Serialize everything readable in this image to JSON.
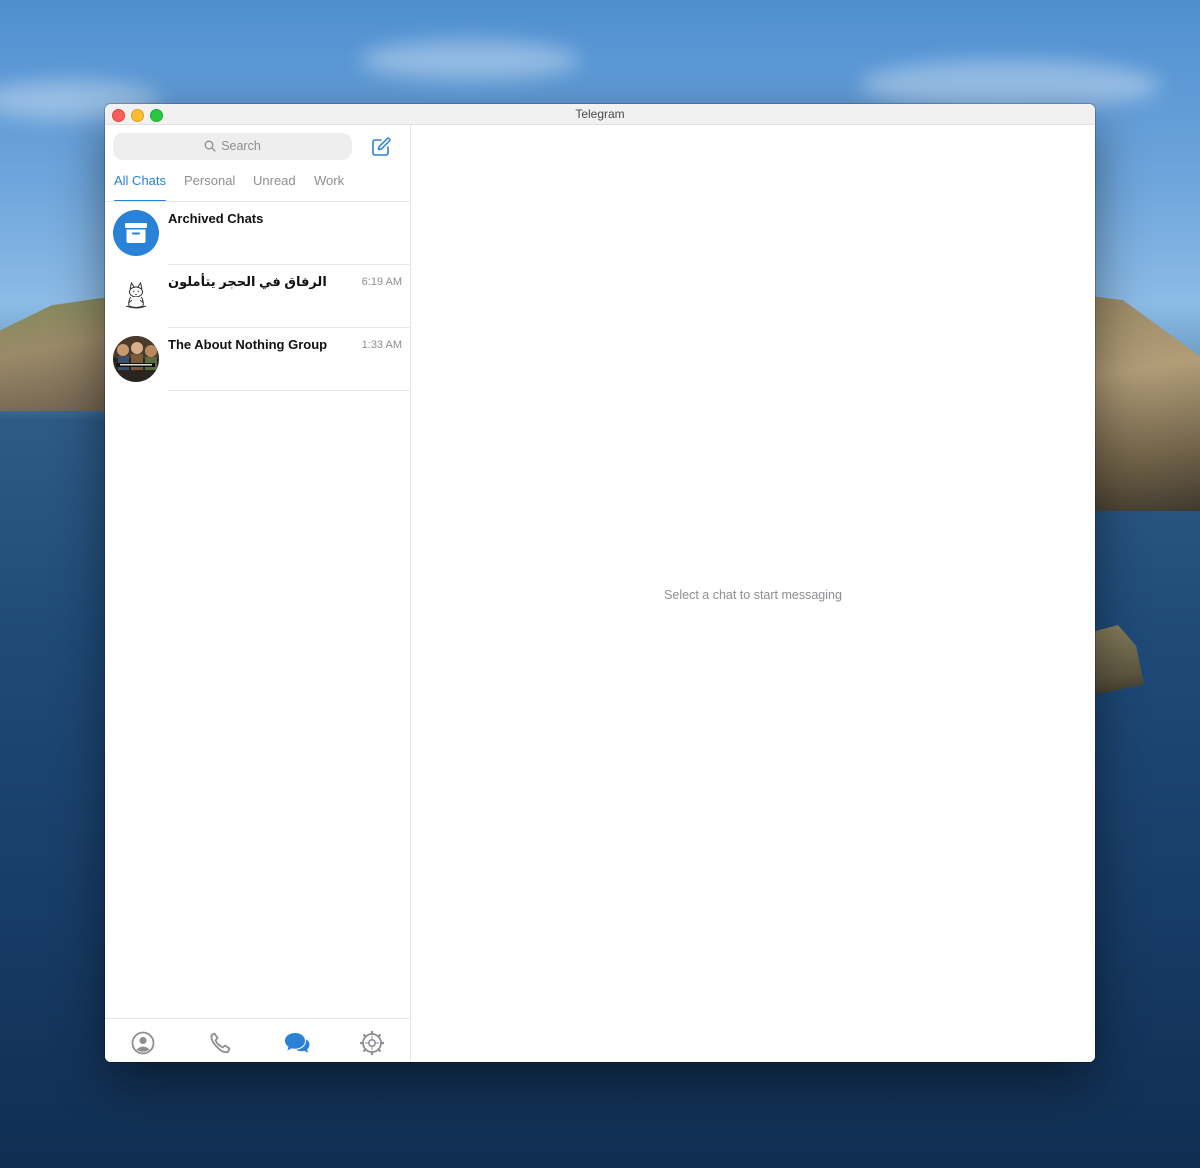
{
  "window": {
    "title": "Telegram"
  },
  "sidebar": {
    "search": {
      "placeholder": "Search"
    },
    "tabs": [
      {
        "label": "All Chats",
        "active": true
      },
      {
        "label": "Personal",
        "active": false
      },
      {
        "label": "Unread",
        "active": false
      },
      {
        "label": "Work",
        "active": false
      }
    ],
    "chats": [
      {
        "name": "Archived Chats",
        "time": "",
        "avatar": "archive-icon"
      },
      {
        "name": "الرفاق في الحجر يتأملون",
        "time": "6:19 AM",
        "avatar": "cat-sticker"
      },
      {
        "name": "The About Nothing Group",
        "time": "1:33 AM",
        "avatar": "group-photo"
      }
    ],
    "bottom_nav": [
      "contacts-icon",
      "calls-icon",
      "chats-icon",
      "settings-icon"
    ]
  },
  "main": {
    "empty_message": "Select a chat to start messaging"
  },
  "colors": {
    "accent": "#2a82d7",
    "muted": "#8e8e93"
  }
}
